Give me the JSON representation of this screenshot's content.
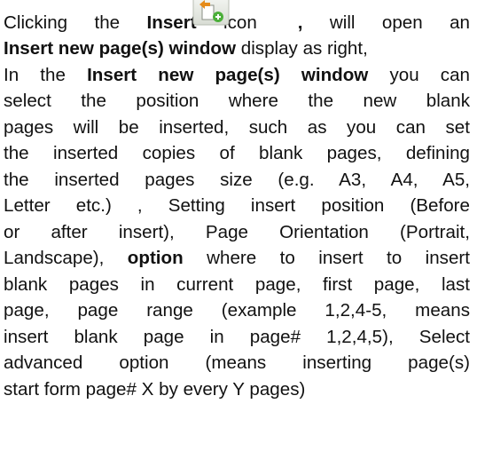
{
  "paragraph": {
    "l1": {
      "pre": "Clicking the ",
      "b1": "Insert",
      "mid": " icon",
      "b2": ",",
      "post": " will open an"
    },
    "l2": {
      "b1": "Insert new page(s) window",
      "post": " display as right,"
    },
    "l3": {
      "pre": "In the ",
      "b1": "Insert new page(s) window",
      "post": " you can"
    },
    "l4": "select the position where the new blank",
    "l5": "pages will be inserted, such as you can set",
    "l6": "the inserted copies of blank pages, defining",
    "l7": "the inserted pages size (e.g. A3, A4, A5,",
    "l8": "Letter etc.)  , Setting insert position (Before",
    "l9": "or after insert), Page Orientation (Portrait,",
    "l10": {
      "pre": "Landscape), ",
      "b1": "option",
      "post": " where to insert to insert"
    },
    "l11": "blank pages in current page, first page, last",
    "l12": "page, page range (example 1,2,4-5, means",
    "l13": "insert blank page in page# 1,2,4,5), Select",
    "l14": "advanced option (means inserting page(s)",
    "l15": "start form page# X by every Y pages)"
  },
  "icon": {
    "name": "insert-page-icon"
  }
}
